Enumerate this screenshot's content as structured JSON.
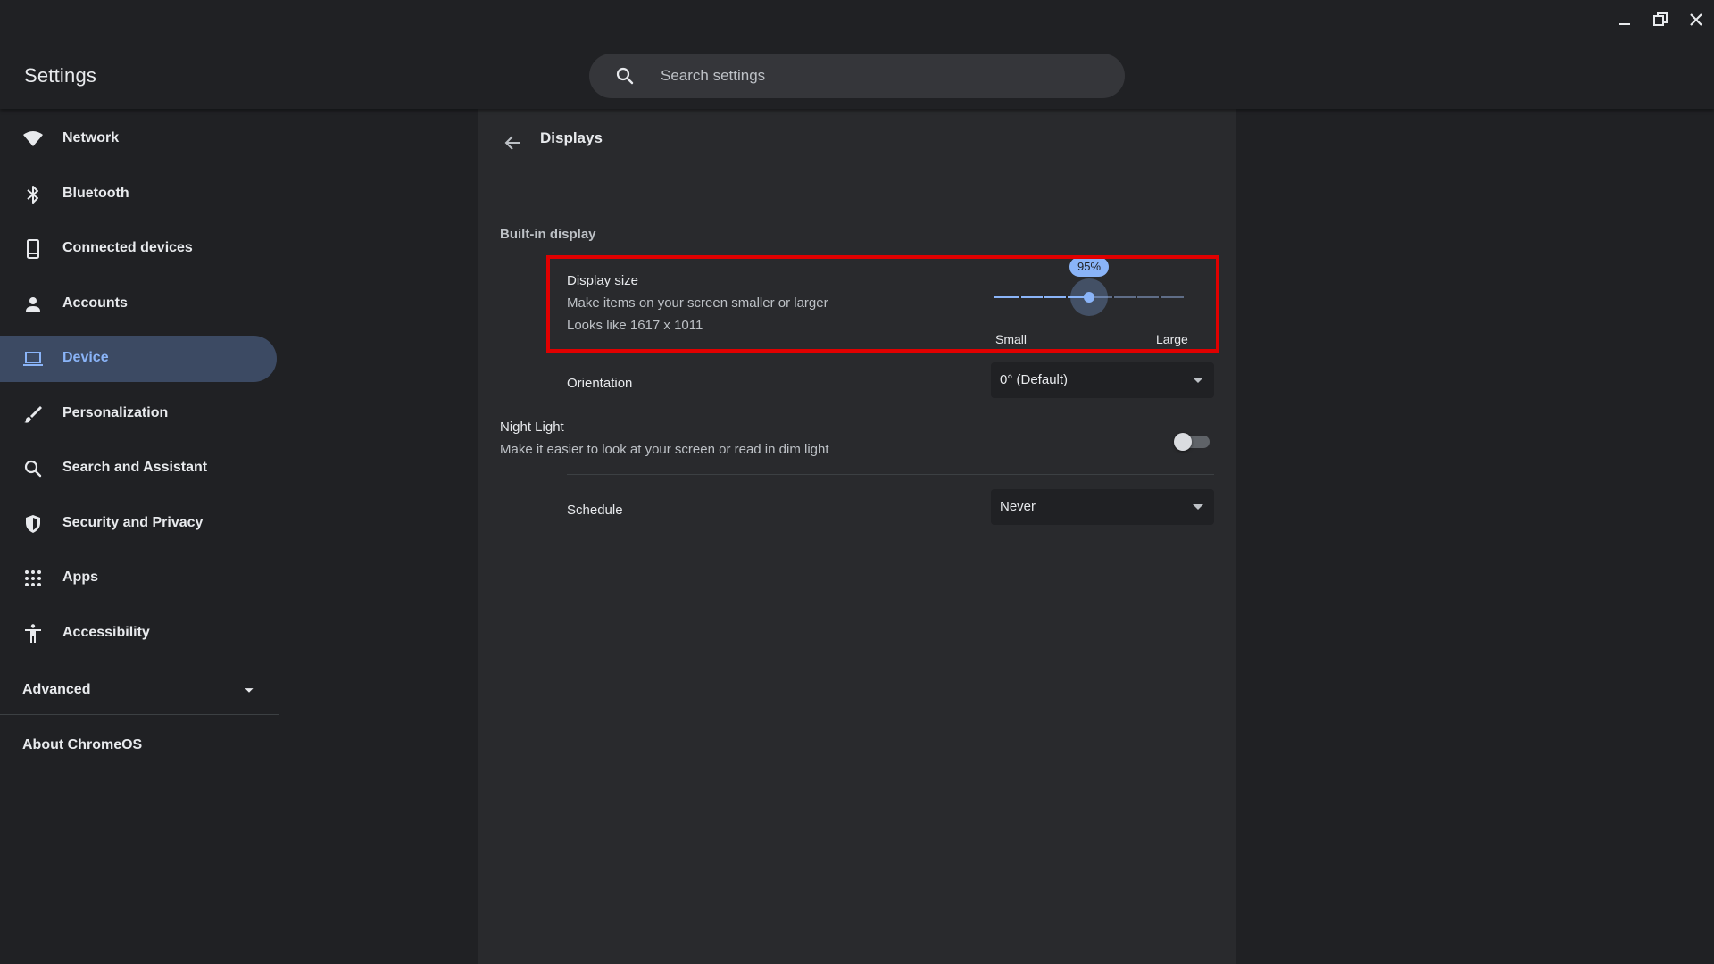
{
  "app": {
    "title": "Settings"
  },
  "search": {
    "placeholder": "Search settings",
    "value": ""
  },
  "window_controls": {
    "minimize": "minimize-icon",
    "restore": "restore-icon",
    "close": "close-icon"
  },
  "sidebar": {
    "items": [
      {
        "label": "Network",
        "icon": "wifi-icon",
        "active": false
      },
      {
        "label": "Bluetooth",
        "icon": "bluetooth-icon",
        "active": false
      },
      {
        "label": "Connected devices",
        "icon": "phone-icon",
        "active": false
      },
      {
        "label": "Accounts",
        "icon": "person-icon",
        "active": false
      },
      {
        "label": "Device",
        "icon": "laptop-icon",
        "active": true
      },
      {
        "label": "Personalization",
        "icon": "brush-icon",
        "active": false
      },
      {
        "label": "Search and Assistant",
        "icon": "search-icon",
        "active": false
      },
      {
        "label": "Security and Privacy",
        "icon": "shield-icon",
        "active": false
      },
      {
        "label": "Apps",
        "icon": "apps-grid-icon",
        "active": false
      },
      {
        "label": "Accessibility",
        "icon": "accessibility-icon",
        "active": false
      }
    ],
    "advanced_label": "Advanced",
    "about_label": "About ChromeOS"
  },
  "page": {
    "title": "Displays",
    "section_title": "Built-in display",
    "display_size": {
      "title": "Display size",
      "description": "Make items on your screen smaller or larger",
      "resolution": "Looks like 1617 x 1011",
      "slider_value_label": "95%",
      "slider_fraction": 0.5,
      "slider_min_label": "Small",
      "slider_max_label": "Large"
    },
    "orientation": {
      "label": "Orientation",
      "value": "0° (Default)"
    },
    "night_light": {
      "title": "Night Light",
      "description": "Make it easier to look at your screen or read in dim light",
      "enabled": false
    },
    "schedule": {
      "label": "Schedule",
      "value": "Never"
    }
  },
  "colors": {
    "background": "#202124",
    "card": "#292a2d",
    "accent": "#8ab4f8",
    "active_nav": "#3c4a63",
    "highlight": "#e00000"
  }
}
